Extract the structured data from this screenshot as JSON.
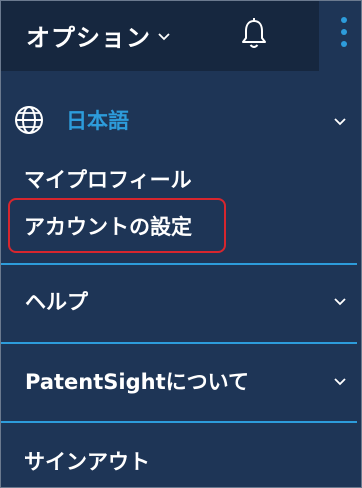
{
  "header": {
    "options_label": "オプション",
    "icons": {
      "options_chevron": "chevron-down-icon",
      "notifications": "bell-icon",
      "more": "kebab-menu-icon"
    }
  },
  "language": {
    "icon": "globe-icon",
    "label": "日本語"
  },
  "menu": {
    "profile": "マイプロフィール",
    "account_settings": "アカウントの設定"
  },
  "sections": {
    "help": "ヘルプ",
    "about": "PatentSightについて",
    "sign_out": "サインアウト"
  },
  "colors": {
    "background": "#1e3556",
    "topbar": "#16273f",
    "accent": "#2d9cdb",
    "highlight": "#d7262e"
  }
}
